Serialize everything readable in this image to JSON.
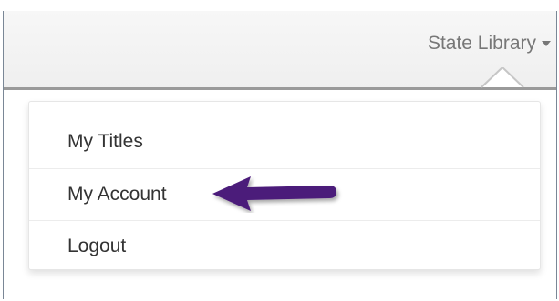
{
  "navbar": {
    "user_menu_label": "State Library",
    "caret_icon": "caret-down-icon"
  },
  "dropdown": {
    "items": [
      {
        "label": "My Titles"
      },
      {
        "label": "My Account"
      },
      {
        "label": "Logout"
      }
    ]
  },
  "annotation": {
    "icon": "arrow-left-icon",
    "color": "#4b1a7a"
  }
}
